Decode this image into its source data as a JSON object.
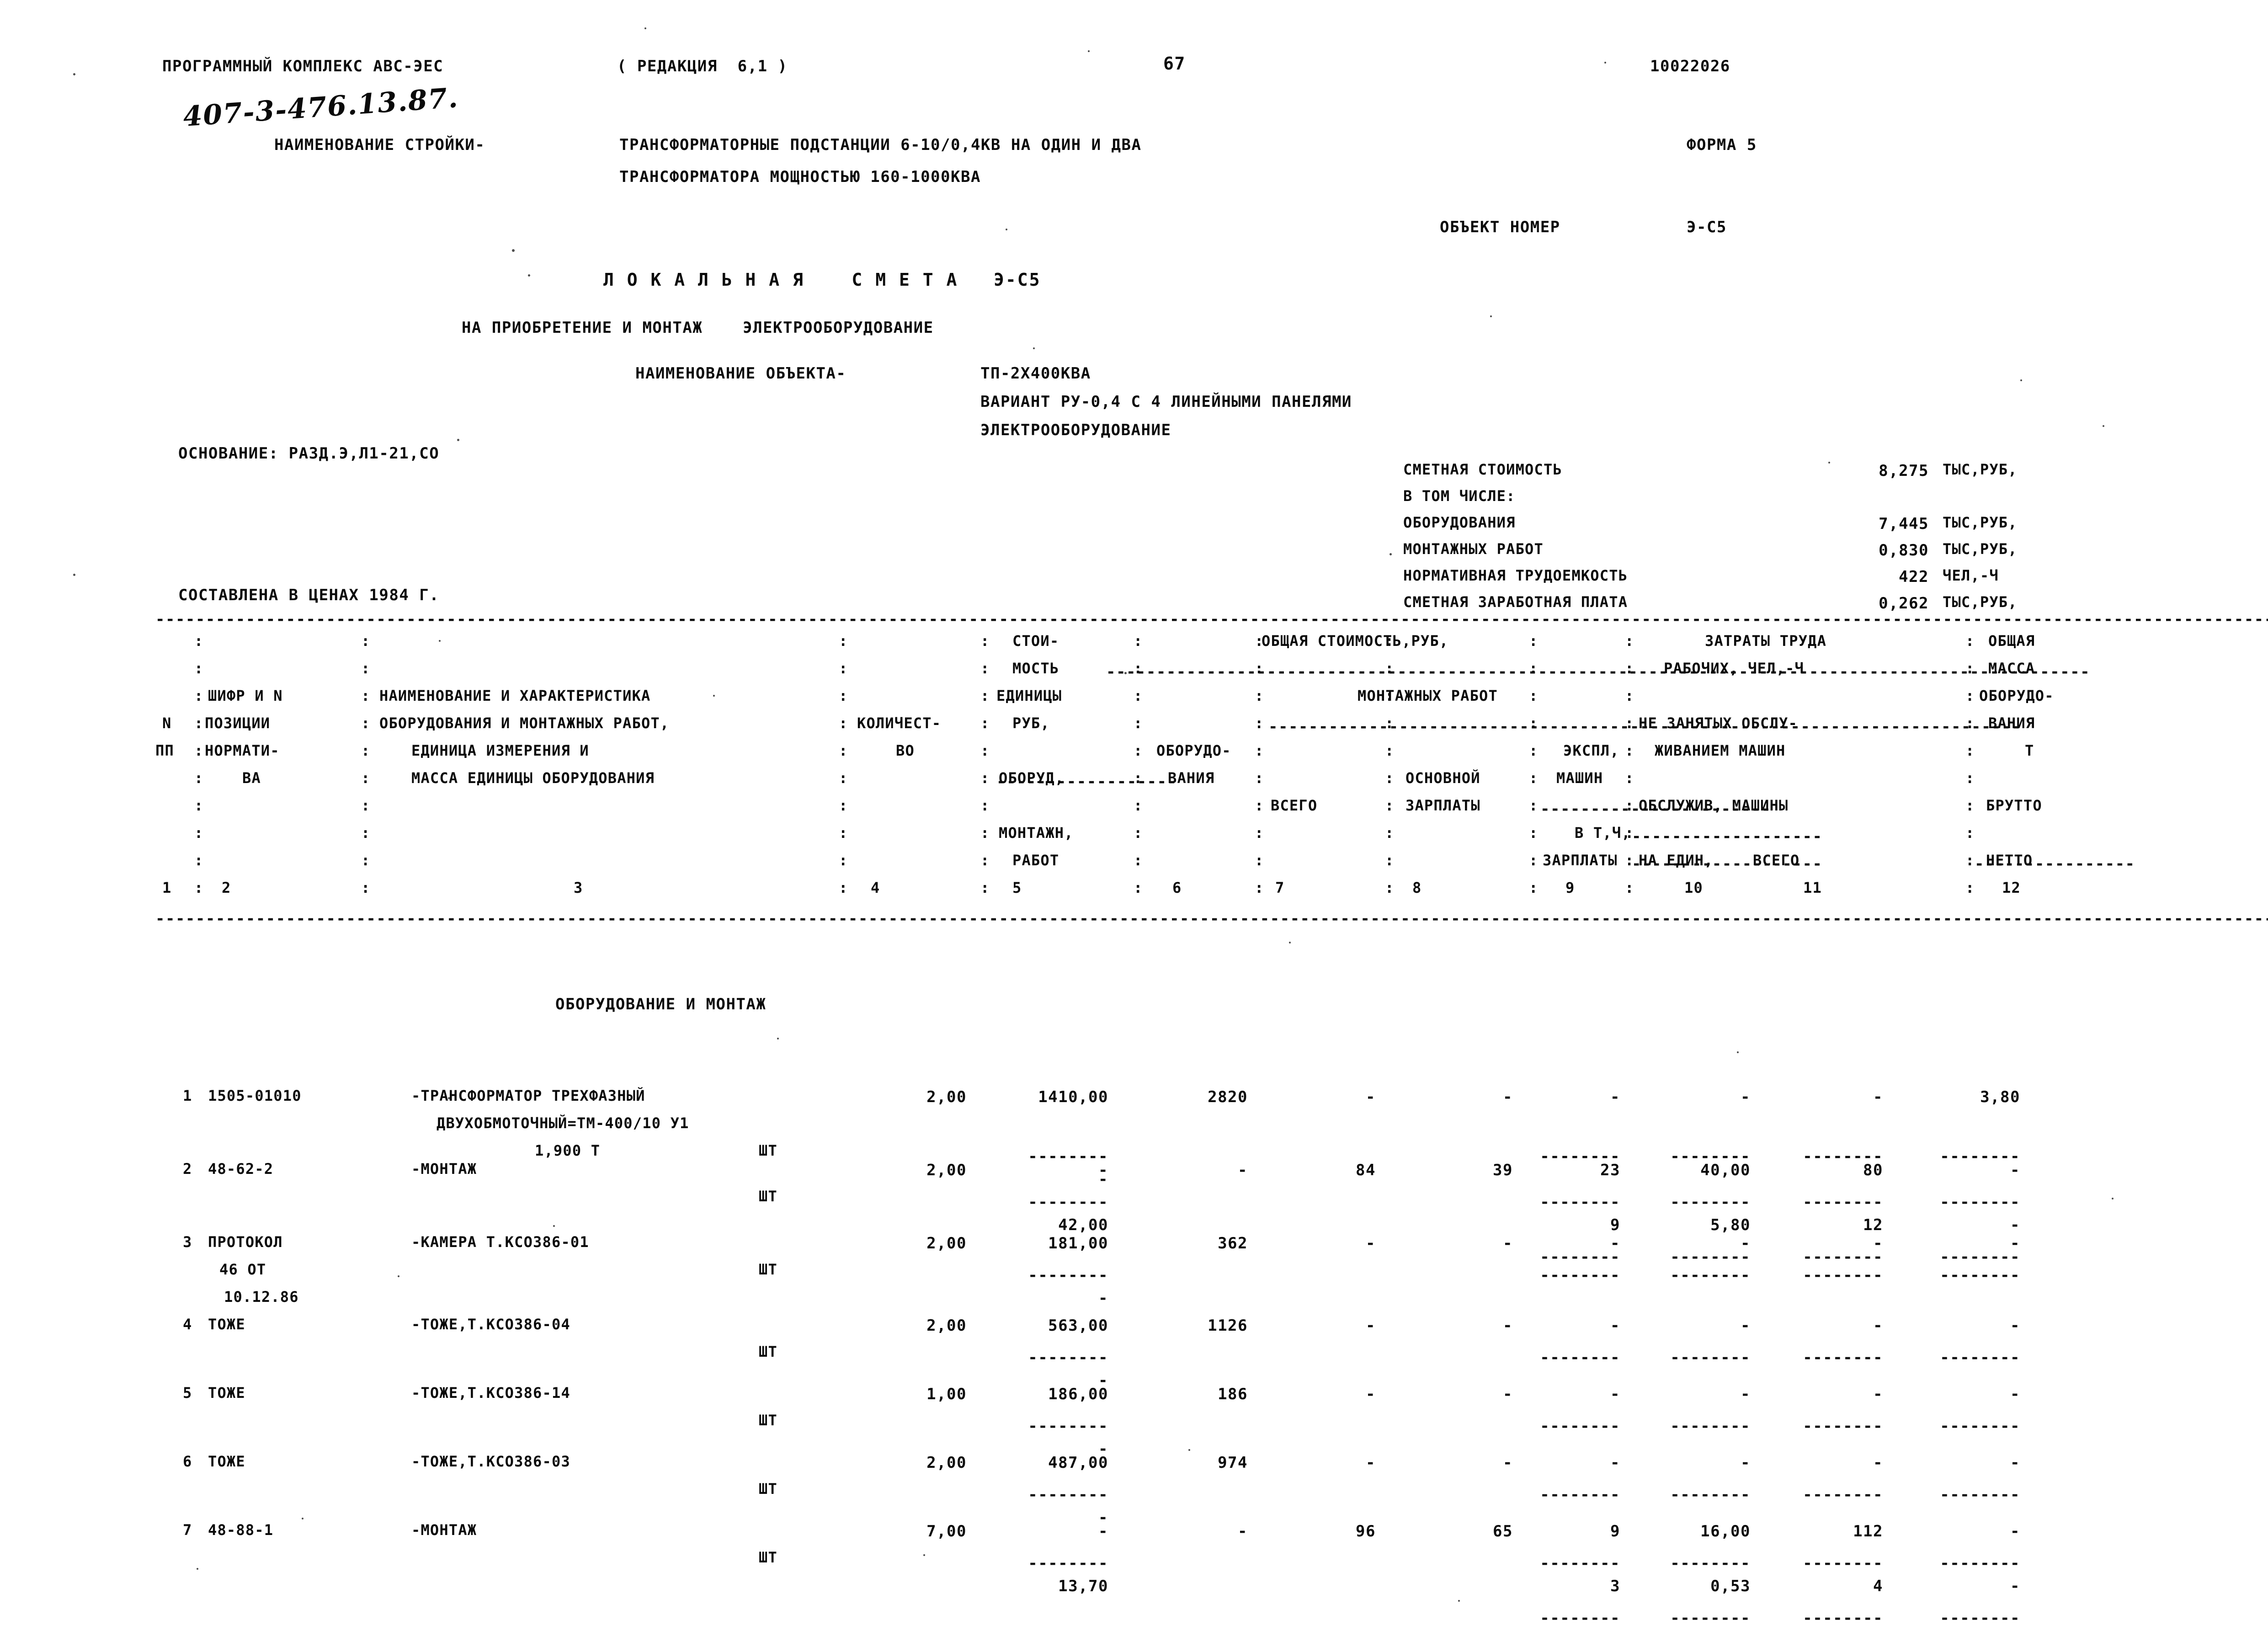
{
  "header": {
    "program": "ПРОГРАММНЫЙ КОМПЛЕКС АВС-ЭЕС",
    "revision": "( РЕДАКЦИЯ  6,1 )",
    "page_number": "67",
    "doc_code": "10022026",
    "form": "ФОРМА 5",
    "handwritten_code": "407-3-476.13.87.",
    "series_label": "НАИМЕНОВАНИЕ СТРОЙКИ-",
    "series_line1": "ТРАНСФОРМАТОРНЫЕ ПОДСТАНЦИИ 6-10/0,4КВ НА ОДИН И ДВА",
    "series_line2": "ТРАНСФОРМАТОРА МОЩНОСТЬЮ 160-1000КВА",
    "object_number_label": "ОБЪЕКТ НОМЕР",
    "object_number_value": "Э-С5"
  },
  "title": {
    "main": "Л О К А Л Ь Н А Я    С М Е Т А   Э-С5",
    "purpose": "НА ПРИОБРЕТЕНИЕ И МОНТАЖ    ЭЛЕКТРООБОРУДОВАНИЕ",
    "object_label": "НАИМЕНОВАНИЕ ОБЪЕКТА-",
    "object_line1": "ТП-2Х400КВА",
    "object_line2": "ВАРИАНТ РУ-0,4 С 4 ЛИНЕЙНЫМИ ПАНЕЛЯМИ",
    "object_line3": "ЭЛЕКТРООБОРУДОВАНИЕ",
    "basis": "ОСНОВАНИЕ: РАЗД.Э,Л1-21,СО",
    "prices": "СОСТАВЛЕНА В ЦЕНАХ 1984 Г."
  },
  "summary": {
    "rows": [
      {
        "label": "СМЕТНАЯ СТОИМОСТЬ",
        "value": "8,275",
        "unit": "ТЫС,РУБ,"
      },
      {
        "label": "В ТОМ ЧИСЛЕ:",
        "value": "",
        "unit": ""
      },
      {
        "label": "ОБОРУДОВАНИЯ",
        "value": "7,445",
        "unit": "ТЫС,РУБ,"
      },
      {
        "label": "МОНТАЖНЫХ РАБОТ",
        "value": "0,830",
        "unit": "ТЫС,РУБ,"
      },
      {
        "label": "НОРМАТИВНАЯ ТРУДОЕМКОСТЬ",
        "value": "422",
        "unit": "ЧЕЛ,-Ч"
      },
      {
        "label": "СМЕТНАЯ ЗАРАБОТНАЯ ПЛАТА",
        "value": "0,262",
        "unit": "ТЫС,РУБ,"
      }
    ]
  },
  "table_header": {
    "col_n_1": "N",
    "col_n_2": "ПП",
    "col_code_1": "ШИФР И N",
    "col_code_2": "ПОЗИЦИИ",
    "col_code_3": "НОРМАТИ-",
    "col_code_4": "ВА",
    "col_name_1": "НАИМЕНОВАНИЕ И ХАРАКТЕРИСТИКА",
    "col_name_2": "ОБОРУДОВАНИЯ И МОНТАЖНЫХ РАБОТ,",
    "col_name_3": "ЕДИНИЦА ИЗМЕРЕНИЯ И",
    "col_name_4": "МАССА ЕДИНИЦЫ ОБОРУДОВАНИЯ",
    "col_qty_1": "КОЛИЧЕСТ-",
    "col_qty_2": "ВО",
    "col_unitcost_1": "СТОИ-",
    "col_unitcost_2": "МОСТЬ",
    "col_unitcost_3": "ЕДИНИЦЫ",
    "col_unitcost_4": "РУБ,",
    "col_unitcost_5": "ОБОРУД,",
    "col_unitcost_6": "МОНТАЖН,",
    "col_unitcost_7": "РАБОТ",
    "col_total_title": "ОБЩАЯ СТОИМОСТЬ,РУБ,",
    "col_total_equip_1": "ОБОРУДО-",
    "col_total_equip_2": "ВАНИЯ",
    "col_mount_title": "МОНТАЖНЫХ РАБОТ",
    "col_mount_all": "ВСЕГО",
    "col_mount_basic_1": "ОСНОВНОЙ",
    "col_mount_basic_2": "ЗАРПЛАТЫ",
    "col_mount_mach_1": "ЭКСПЛ,",
    "col_mount_mach_2": "МАШИН",
    "col_mount_mach_3": "В Т,Ч,",
    "col_mount_mach_4": "ЗАРПЛАТЫ",
    "col_labor_title": "ЗАТРАТЫ ТРУДА",
    "col_labor_1": "РАБОЧИХ, ЧЕЛ,-Ч",
    "col_labor_2": "НЕ ЗАНЯТЫХ ОБСЛУ-",
    "col_labor_3": "ЖИВАНИЕМ МАШИН",
    "col_labor_4": "ОБСЛУЖИВ, МАШИНЫ",
    "col_labor_5": "НА ЕДИН,",
    "col_labor_6": "ВСЕГО",
    "col_mass_1": "ОБЩАЯ",
    "col_mass_2": "МАССА",
    "col_mass_3": "ОБОРУДО-",
    "col_mass_4": "ВАНИЯ",
    "col_mass_5": "Т",
    "col_mass_6": "БРУТТО",
    "col_mass_7": "НЕТТО",
    "numbers": [
      "1",
      "2",
      "3",
      "4",
      "5",
      "6",
      "7",
      "8",
      "9",
      "10",
      "11",
      "12"
    ]
  },
  "section_title": "ОБОРУДОВАНИЕ И МОНТАЖ",
  "rows": [
    {
      "n": "1",
      "code": "1505-01010",
      "name": "-ТРАНСФОРМАТОР ТРЕХФАЗНЫЙ",
      "name2": "ДВУХОБМОТОЧНЫЙ=ТМ-400/10 У1",
      "mass": "1,900 Т",
      "unit": "ШТ",
      "qty": "2,00",
      "unit_cost": "1410,00",
      "unit_cost2": "-",
      "total_equip": "2820",
      "total_all": "-",
      "total_basic": "-",
      "mach": "-",
      "per_unit": "-",
      "labor_all": "-",
      "mass_total": "-",
      "mass_net": "3,80"
    },
    {
      "n": "2",
      "code": "48-62-2",
      "name": "-МОНТАЖ",
      "name2": "",
      "mass": "",
      "unit": "ШТ",
      "qty": "2,00",
      "unit_cost": "-",
      "unit_cost2": "42,00",
      "total_equip": "-",
      "total_all": "84",
      "total_basic": "39",
      "mach": "23",
      "per_unit": "40,00",
      "labor_all": "80",
      "mass_total": "-",
      "mach2": "9",
      "per_unit2": "5,80",
      "labor_all2": "12",
      "mass_net": "-"
    },
    {
      "n": "3",
      "code": "ПРОТОКОЛ",
      "code2": "46 ОТ",
      "code3": "10.12.86",
      "name": "-КАМЕРА Т.КСО386-01",
      "name2": "",
      "mass": "",
      "unit": "ШТ",
      "qty": "2,00",
      "unit_cost": "181,00",
      "unit_cost2": "-",
      "total_equip": "362",
      "total_all": "-",
      "total_basic": "-",
      "mach": "-",
      "per_unit": "-",
      "labor_all": "-",
      "mass_total": "-",
      "mass_net": "-"
    },
    {
      "n": "4",
      "code": "ТОЖЕ",
      "name": "-ТОЖЕ,Т.КСО386-04",
      "name2": "",
      "mass": "",
      "unit": "ШТ",
      "qty": "2,00",
      "unit_cost": "563,00",
      "unit_cost2": "-",
      "total_equip": "1126",
      "total_all": "-",
      "total_basic": "-",
      "mach": "-",
      "per_unit": "-",
      "labor_all": "-",
      "mass_total": "-",
      "mass_net": "-"
    },
    {
      "n": "5",
      "code": "ТОЖЕ",
      "name": "-ТОЖЕ,Т.КСО386-14",
      "name2": "",
      "mass": "",
      "unit": "ШТ",
      "qty": "1,00",
      "unit_cost": "186,00",
      "unit_cost2": "-",
      "total_equip": "186",
      "total_all": "-",
      "total_basic": "-",
      "mach": "-",
      "per_unit": "-",
      "labor_all": "-",
      "mass_total": "-",
      "mass_net": "-"
    },
    {
      "n": "6",
      "code": "ТОЖЕ",
      "name": "-ТОЖЕ,Т.КСО386-03",
      "name2": "",
      "mass": "",
      "unit": "ШТ",
      "qty": "2,00",
      "unit_cost": "487,00",
      "unit_cost2": "-",
      "total_equip": "974",
      "total_all": "-",
      "total_basic": "-",
      "mach": "-",
      "per_unit": "-",
      "labor_all": "-",
      "mass_total": "-",
      "mass_net": "-"
    },
    {
      "n": "7",
      "code": "48-88-1",
      "name": "-МОНТАЖ",
      "name2": "",
      "mass": "",
      "unit": "ШТ",
      "qty": "7,00",
      "unit_cost": "-",
      "unit_cost2": "13,70",
      "total_equip": "-",
      "total_all": "96",
      "total_basic": "65",
      "mach": "9",
      "per_unit": "16,00",
      "labor_all": "112",
      "mass_total": "-",
      "mach2": "3",
      "per_unit2": "0,53",
      "labor_all2": "4",
      "mass_net": "-"
    }
  ]
}
